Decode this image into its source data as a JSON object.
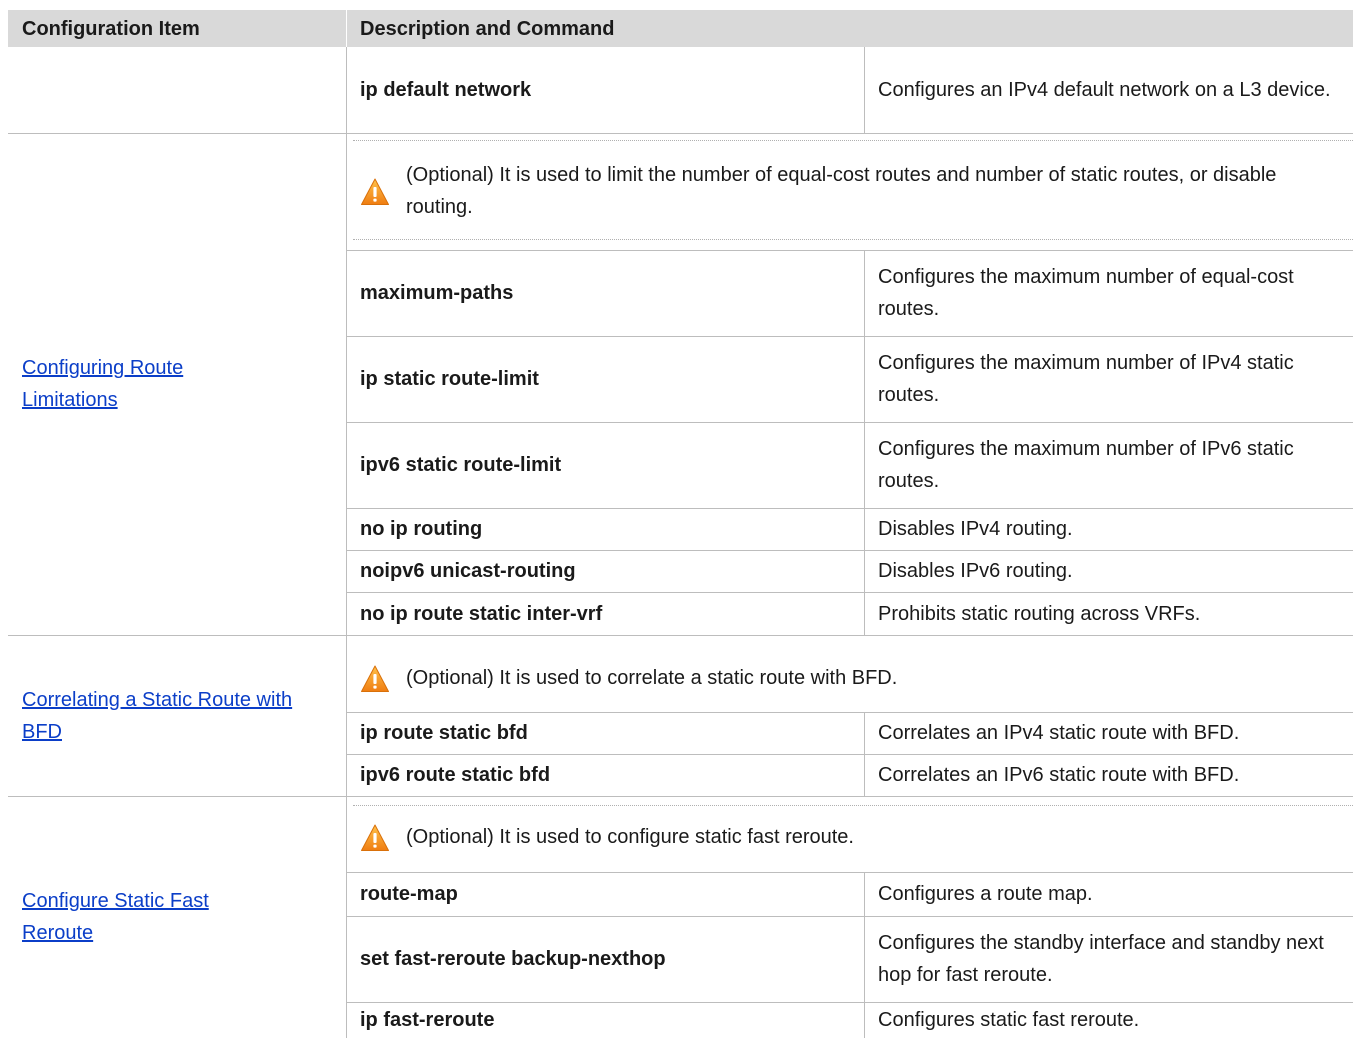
{
  "header": {
    "col1": "Configuration Item",
    "col2": "Description and Command"
  },
  "group0": {
    "rows": [
      {
        "command": "ip default network",
        "description": "Configures an IPv4 default network on a L3 device."
      }
    ]
  },
  "group1": {
    "item": "Configuring Route Limitations",
    "note": "(Optional) It is used to limit the number of equal-cost routes and number of static routes, or disable routing.",
    "rows": [
      {
        "command": "maximum-paths",
        "description": "Configures the maximum number of equal-cost routes."
      },
      {
        "command": "ip static route-limit",
        "description": "Configures the maximum number of IPv4 static routes."
      },
      {
        "command": "ipv6 static route-limit",
        "description": "Configures the maximum number of IPv6 static routes."
      },
      {
        "command": "no ip routing",
        "description": "Disables IPv4 routing."
      },
      {
        "command": "noipv6 unicast-routing",
        "description": "Disables IPv6 routing."
      },
      {
        "command": "no ip route static inter-vrf",
        "description": "Prohibits static routing across VRFs."
      }
    ]
  },
  "group2": {
    "item": "Correlating a Static Route with BFD",
    "note": "(Optional) It is used to correlate a static route with BFD.",
    "rows": [
      {
        "command": "ip route static bfd",
        "description": "Correlates an IPv4 static route with BFD."
      },
      {
        "command": "ipv6 route static bfd",
        "description": "Correlates an IPv6 static route with BFD."
      }
    ]
  },
  "group3": {
    "item": "Configure Static Fast Reroute",
    "note": "(Optional) It is used to configure static fast reroute.",
    "rows": [
      {
        "command": "route-map",
        "description": "Configures a route map."
      },
      {
        "command": "set fast-reroute backup-nexthop",
        "description": "Configures the standby interface and standby next hop for fast reroute."
      },
      {
        "command": "ip fast-reroute",
        "description": "Configures static fast reroute."
      }
    ]
  },
  "icons": {
    "warning": "warning-triangle-icon"
  },
  "colors": {
    "header_bg": "#d9d9d9",
    "link": "#0b3ec8",
    "warning_fill": "#f5a623",
    "border": "#bdbdbd"
  }
}
